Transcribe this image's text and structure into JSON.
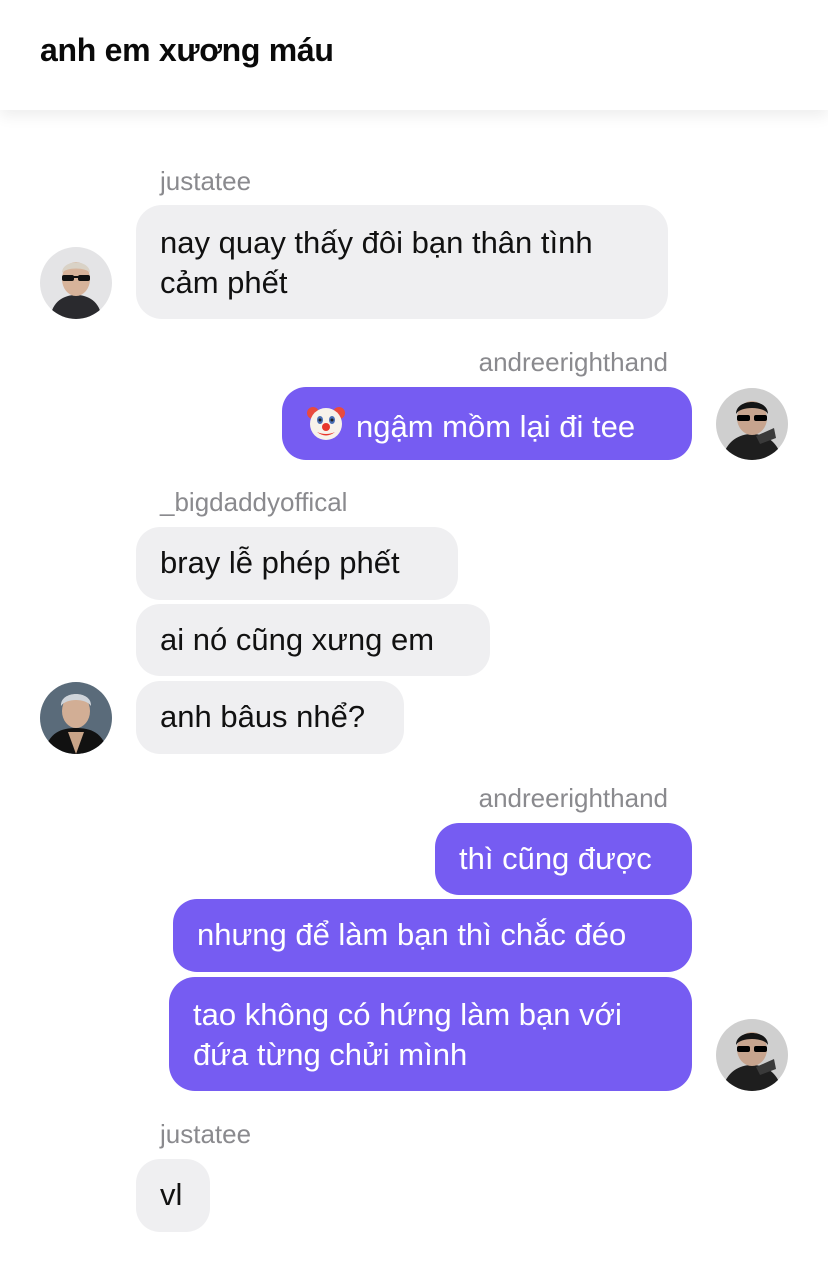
{
  "header": {
    "title": "anh em xương máu"
  },
  "messages": [
    {
      "user": "justatee",
      "text_lines": [
        "nay quay thấy đôi bạn thân tình",
        "cảm phết"
      ]
    },
    {
      "user": "andreerighthand",
      "emoji": "clown-face",
      "text": "ngậm mồm lại đi tee"
    },
    {
      "user": "_bigdaddyoffical",
      "texts": [
        "bray lễ phép phết",
        "ai nó cũng xưng em",
        "anh bâus nhể?"
      ]
    },
    {
      "user": "andreerighthand",
      "texts": [
        "thì cũng được",
        "nhưng để làm bạn thì chắc đéo"
      ],
      "text_lines": [
        "tao không có hứng làm bạn với",
        "đứa từng chửi mình"
      ]
    },
    {
      "user": "justatee",
      "text": "vl"
    }
  ],
  "colors": {
    "outgoing_bubble": "#765cf2",
    "incoming_bubble": "#efeff1",
    "username": "#8a8a8e"
  }
}
